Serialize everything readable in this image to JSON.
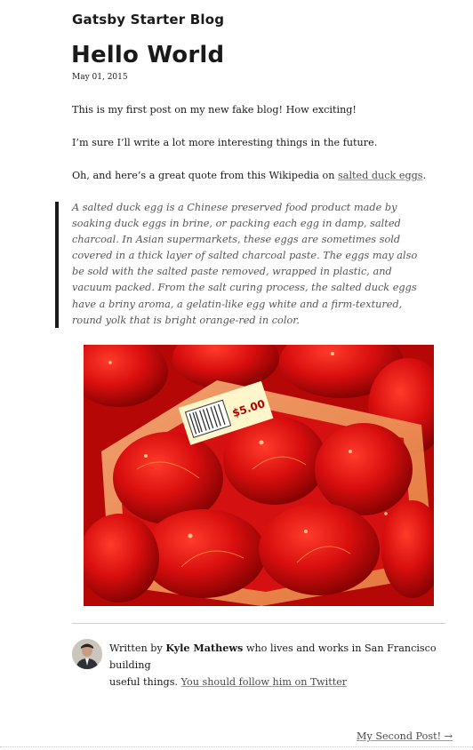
{
  "site": {
    "title": "Gatsby Starter Blog"
  },
  "post": {
    "title": "Hello World",
    "date": "May 01, 2015",
    "paragraphs": [
      "This is my first post on my new fake blog! How exciting!",
      "I’m sure I’ll write a lot more interesting things in the future."
    ],
    "quote_intro": {
      "before": "Oh, and here’s a great quote from this Wikipedia on ",
      "link": "salted duck eggs",
      "after": "."
    },
    "quote_lines": [
      "A salted duck egg is a Chinese preserved food product made by",
      "soaking duck eggs in brine, or packing each egg in damp, salted",
      "charcoal. In Asian supermarkets, these eggs are sometimes sold",
      "covered in a thick layer of salted charcoal paste. The eggs may also",
      "be sold with the salted paste removed, wrapped in plastic, and",
      "vacuum packed. From the salt curing process, the salted duck eggs",
      "have a briny aroma, a gelatin-like egg white and a firm-textured,",
      "round yolk that is bright orange-red in color."
    ],
    "image": {
      "subject": "red salted duck eggs in a plastic tray",
      "price": "$5.00"
    }
  },
  "bio": {
    "written_by": "Written by ",
    "author": "Kyle Mathews",
    "line1_rest": " who lives and works in San Francisco building",
    "line2_start": "useful things. ",
    "follow_link": "You should follow him on Twitter"
  },
  "nav": {
    "next_label": "My Second Post! →"
  },
  "colors": {
    "text": "#1a1a1a",
    "link": "#4a4a4a",
    "quote_text": "#555555",
    "egg_red": "#d01010"
  }
}
